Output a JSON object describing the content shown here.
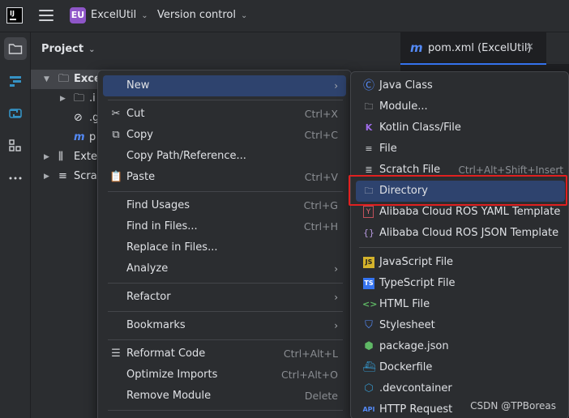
{
  "titlebar": {
    "logo_text": "IJ",
    "project_badge": "EU",
    "project_name": "ExcelUtil",
    "vcs_label": "Version control"
  },
  "project_panel": {
    "title": "Project",
    "rows": [
      {
        "label": "Exce",
        "icon": "module-folder-icon"
      },
      {
        "label": ".i",
        "icon": "folder-icon"
      },
      {
        "label": ".g",
        "icon": "ignore-icon"
      },
      {
        "label": "p",
        "icon": "maven-icon"
      },
      {
        "label": "Exter",
        "icon": "library-icon"
      },
      {
        "label": "Scrat",
        "icon": "scratch-icon"
      }
    ]
  },
  "editor": {
    "tab_label": "pom.xml (ExcelUtil)",
    "tab_icon_text": "m"
  },
  "context_menu": {
    "new": "New",
    "cut": "Cut",
    "cut_sc": "Ctrl+X",
    "copy": "Copy",
    "copy_sc": "Ctrl+C",
    "copy_path": "Copy Path/Reference...",
    "paste": "Paste",
    "paste_sc": "Ctrl+V",
    "find_usages": "Find Usages",
    "find_usages_sc": "Ctrl+G",
    "find_in_files": "Find in Files...",
    "find_in_files_sc": "Ctrl+H",
    "replace_in_files": "Replace in Files...",
    "analyze": "Analyze",
    "refactor": "Refactor",
    "bookmarks": "Bookmarks",
    "reformat": "Reformat Code",
    "reformat_sc": "Ctrl+Alt+L",
    "optimize": "Optimize Imports",
    "optimize_sc": "Ctrl+Alt+O",
    "remove_module": "Remove Module",
    "remove_module_sc": "Delete"
  },
  "submenu": {
    "java_class": "Java Class",
    "module": "Module...",
    "kotlin": "Kotlin Class/File",
    "file": "File",
    "scratch": "Scratch File",
    "scratch_sc": "Ctrl+Alt+Shift+Insert",
    "directory": "Directory",
    "ros_yaml": "Alibaba Cloud ROS YAML Template",
    "ros_json": "Alibaba Cloud ROS JSON Template",
    "js": "JavaScript File",
    "ts": "TypeScript File",
    "html": "HTML File",
    "css": "Stylesheet",
    "pkg": "package.json",
    "docker": "Dockerfile",
    "devcontainer": ".devcontainer",
    "http": "HTTP Request",
    "icon_labels": {
      "js": "JS",
      "ts": "TS",
      "api": "API",
      "yaml": "Y"
    }
  },
  "watermark": "CSDN @TPBoreas",
  "colors": {
    "accent": "#3574f0",
    "highlight": "#2e436e",
    "annotation_red": "#e02020"
  }
}
